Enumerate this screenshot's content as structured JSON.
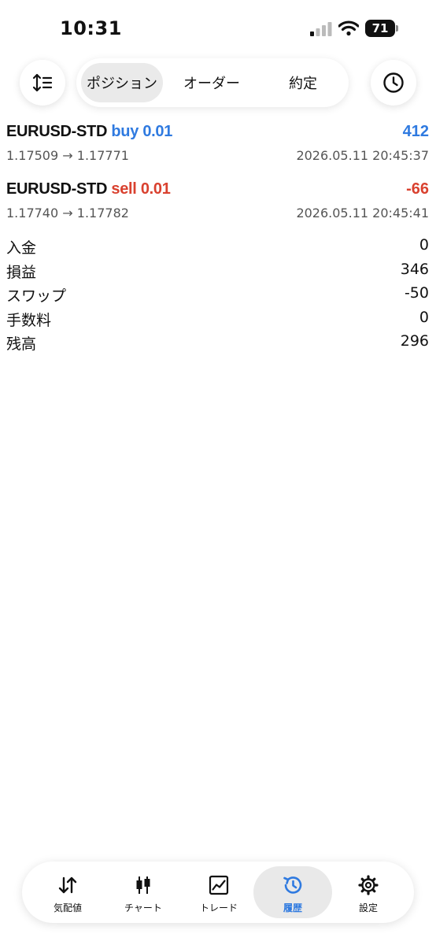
{
  "status_bar": {
    "time": "10:31",
    "battery": "71"
  },
  "top_bar": {
    "tabs": [
      {
        "label": "ポジション",
        "active": true
      },
      {
        "label": "オーダー",
        "active": false
      },
      {
        "label": "約定",
        "active": false
      }
    ]
  },
  "positions": [
    {
      "symbol": "EURUSD-STD",
      "side": "buy",
      "volume": "0.01",
      "profit": "412",
      "open_price": "1.17509",
      "arrow": "→",
      "current_price": "1.17771",
      "time": "2026.05.11 20:45:37",
      "color": "#2f7ae0"
    },
    {
      "symbol": "EURUSD-STD",
      "side": "sell",
      "volume": "0.01",
      "profit": "-66",
      "open_price": "1.17740",
      "arrow": "→",
      "current_price": "1.17782",
      "time": "2026.05.11 20:45:41",
      "color": "#d9412f"
    }
  ],
  "summary": [
    {
      "label": "入金",
      "value": "0"
    },
    {
      "label": "損益",
      "value": "346"
    },
    {
      "label": "スワップ",
      "value": "-50"
    },
    {
      "label": "手数料",
      "value": "0"
    },
    {
      "label": "残高",
      "value": "296"
    }
  ],
  "tabbar": {
    "items": [
      {
        "label": "気配値",
        "icon": "quotes-icon",
        "active": false
      },
      {
        "label": "チャート",
        "icon": "candlestick-icon",
        "active": false
      },
      {
        "label": "トレード",
        "icon": "trade-chart-icon",
        "active": false
      },
      {
        "label": "履歴",
        "icon": "history-icon",
        "active": true
      },
      {
        "label": "設定",
        "icon": "gear-icon",
        "active": false
      }
    ]
  },
  "colors": {
    "accent": "#2f7ae0",
    "loss": "#d9412f"
  }
}
